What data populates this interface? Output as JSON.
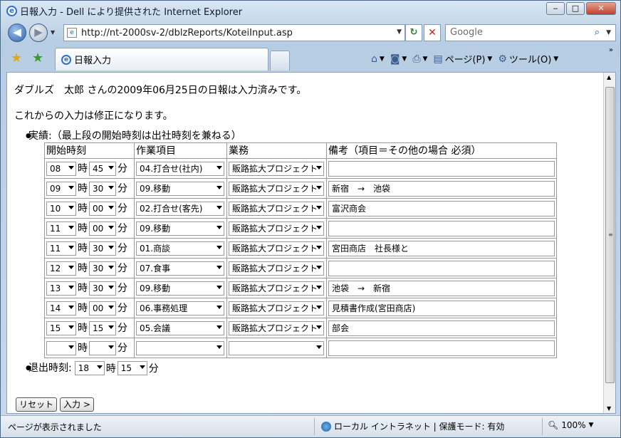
{
  "window": {
    "title": "日報入力 - Dell により提供された Internet Explorer",
    "minimize": "‒",
    "restore": "□",
    "close": "✕"
  },
  "nav": {
    "back_icon": "◀",
    "forward_icon": "▶",
    "address": "http://nt-2000sv-2/dblzReports/KoteiInput.asp",
    "search_placeholder": "Google"
  },
  "tab": {
    "label": "日報入力"
  },
  "commands": {
    "page_label": "ページ(P)",
    "tools_label": "ツール(O)"
  },
  "page": {
    "intro": "ダブルズ　太郎 さんの2009年06月25日の日報は入力済みです。",
    "correction_note": "これからの入力は修正になります。",
    "results_label": "実績:（最上段の開始時刻は出社時刻を兼ねる）",
    "columns": {
      "start_time": "開始時刻",
      "work_item": "作業項目",
      "business": "業務",
      "note": "備考（項目＝その他の場合 必須）"
    },
    "hour_unit": "時",
    "minute_unit": "分",
    "rows": [
      {
        "hour": "08",
        "minute": "45",
        "item": "04.打合せ(社内)",
        "business": "販路拡大プロジェクト",
        "note": ""
      },
      {
        "hour": "09",
        "minute": "30",
        "item": "09.移動",
        "business": "販路拡大プロジェクト",
        "note": "新宿　→　池袋"
      },
      {
        "hour": "10",
        "minute": "00",
        "item": "02.打合せ(客先)",
        "business": "販路拡大プロジェクト",
        "note": "富沢商会"
      },
      {
        "hour": "11",
        "minute": "00",
        "item": "09.移動",
        "business": "販路拡大プロジェクト",
        "note": ""
      },
      {
        "hour": "11",
        "minute": "30",
        "item": "01.商談",
        "business": "販路拡大プロジェクト",
        "note": "宮田商店　社長様と"
      },
      {
        "hour": "12",
        "minute": "30",
        "item": "07.食事",
        "business": "販路拡大プロジェクト",
        "note": ""
      },
      {
        "hour": "13",
        "minute": "30",
        "item": "09.移動",
        "business": "販路拡大プロジェクト",
        "note": "池袋　→　新宿"
      },
      {
        "hour": "14",
        "minute": "00",
        "item": "06.事務処理",
        "business": "販路拡大プロジェクト",
        "note": "見積書作成(宮田商店)"
      },
      {
        "hour": "15",
        "minute": "15",
        "item": "05.会議",
        "business": "販路拡大プロジェクト",
        "note": "部会"
      },
      {
        "hour": "",
        "minute": "",
        "item": "",
        "business": "",
        "note": ""
      }
    ],
    "leave_label": "退出時刻:",
    "leave_hour": "18",
    "leave_minute": "15",
    "reset_button": "リセット",
    "submit_button": "入力 >"
  },
  "status": {
    "message": "ページが表示されました",
    "zone": "ローカル イントラネット | 保護モード: 有効",
    "zoom": "100%"
  }
}
